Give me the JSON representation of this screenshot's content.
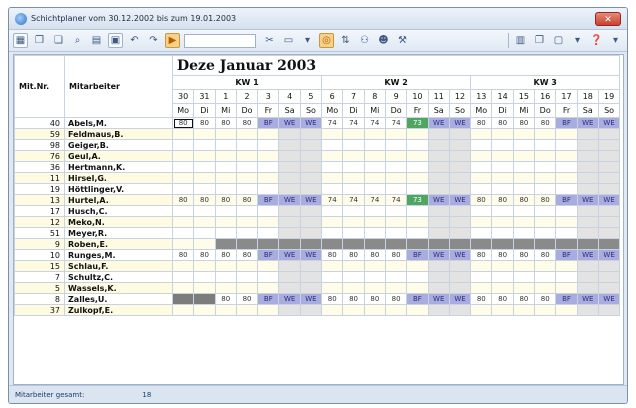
{
  "window": {
    "title": "Schichtplaner vom 30.12.2002 bis zum 19.01.2003",
    "close": "✕"
  },
  "toolbar": {
    "icons": [
      "excel-icon",
      "copy-icon",
      "paste-icon",
      "find-icon",
      "document-icon",
      "print-icon",
      "undo-icon",
      "redo-icon",
      "play-icon"
    ],
    "right_icons": [
      "person-delete-icon",
      "page-icon",
      "circle-select-icon",
      "sort-icon",
      "group-icon",
      "person-add-icon",
      "wrench-icon",
      "clipboard-icon",
      "copy-icon",
      "window-icon",
      "help-icon"
    ]
  },
  "grid": {
    "col_nr": "Mit.Nr.",
    "col_name": "Mitarbeiter",
    "month": "Deze  Januar 2003",
    "weeks": [
      "KW 1",
      "KW 2",
      "KW 3"
    ],
    "days": [
      "30",
      "31",
      "1",
      "2",
      "3",
      "4",
      "5",
      "6",
      "7",
      "8",
      "9",
      "10",
      "11",
      "12",
      "13",
      "14",
      "15",
      "16",
      "17",
      "18",
      "19"
    ],
    "daynames": [
      "Mo",
      "Di",
      "Mi",
      "Do",
      "Fr",
      "Sa",
      "So",
      "Mo",
      "Di",
      "Mi",
      "Do",
      "Fr",
      "Sa",
      "So",
      "Mo",
      "Di",
      "Mi",
      "Do",
      "Fr",
      "Sa",
      "So"
    ],
    "rows": [
      {
        "nr": "40",
        "name": "Abels,M.",
        "cells": [
          "80",
          "80",
          "80",
          "80",
          "BF",
          "WE",
          "WE",
          "74",
          "74",
          "74",
          "74",
          "73",
          "WE",
          "WE",
          "80",
          "80",
          "80",
          "80",
          "BF",
          "WE",
          "WE"
        ]
      },
      {
        "nr": "59",
        "name": "Feldmaus,B.",
        "cells": []
      },
      {
        "nr": "98",
        "name": "Geiger,B.",
        "cells": []
      },
      {
        "nr": "76",
        "name": "Geul,A.",
        "cells": []
      },
      {
        "nr": "36",
        "name": "Hertmann,K.",
        "cells": []
      },
      {
        "nr": "11",
        "name": "Hirsel,G.",
        "cells": []
      },
      {
        "nr": "19",
        "name": "Höttlinger,V.",
        "cells": []
      },
      {
        "nr": "13",
        "name": "Hurtel,A.",
        "cells": [
          "80",
          "80",
          "80",
          "80",
          "BF",
          "WE",
          "WE",
          "74",
          "74",
          "74",
          "74",
          "73",
          "WE",
          "WE",
          "80",
          "80",
          "80",
          "80",
          "BF",
          "WE",
          "WE"
        ]
      },
      {
        "nr": "17",
        "name": "Husch,C.",
        "cells": []
      },
      {
        "nr": "12",
        "name": "Meko,N.",
        "cells": []
      },
      {
        "nr": "51",
        "name": "Meyer,R.",
        "cells": []
      },
      {
        "nr": "9",
        "name": "Roben,E.",
        "cells": [
          "",
          "",
          "#gray",
          "#gray",
          "#gray",
          "#gray",
          "#gray",
          "#gray",
          "#gray",
          "#gray",
          "#gray",
          "#gray",
          "#gray",
          "#gray",
          "#gray",
          "#gray",
          "#gray",
          "#gray",
          "#gray",
          "#gray",
          "#gray"
        ]
      },
      {
        "nr": "10",
        "name": "Runges,M.",
        "cells": [
          "80",
          "80",
          "80",
          "80",
          "BF",
          "WE",
          "WE",
          "80",
          "80",
          "80",
          "80",
          "BF",
          "WE",
          "WE",
          "80",
          "80",
          "80",
          "80",
          "BF",
          "WE",
          "WE"
        ]
      },
      {
        "nr": "15",
        "name": "Schlau,F.",
        "cells": []
      },
      {
        "nr": "7",
        "name": "Schultz,C.",
        "cells": []
      },
      {
        "nr": "5",
        "name": "Wassels,K.",
        "cells": []
      },
      {
        "nr": "8",
        "name": "Zalles,U.",
        "cells": [
          "#dark",
          "#dark",
          "80",
          "80",
          "BF",
          "WE",
          "WE",
          "80",
          "80",
          "80",
          "80",
          "BF",
          "WE",
          "WE",
          "80",
          "80",
          "80",
          "80",
          "BF",
          "WE",
          "WE"
        ]
      },
      {
        "nr": "37",
        "name": "Zulkopf,E.",
        "cells": []
      }
    ],
    "selected_row": 0,
    "selected_col": 0
  },
  "status": {
    "label": "Mitarbeiter gesamt:",
    "value": "18"
  }
}
